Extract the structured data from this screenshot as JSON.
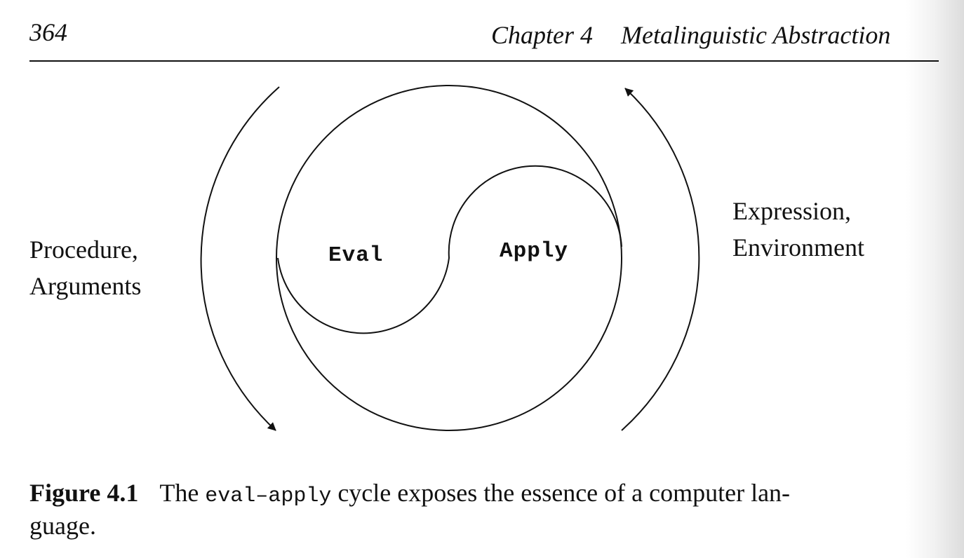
{
  "header": {
    "page_number": "364",
    "chapter": "Chapter 4",
    "title": "Metalinguistic Abstraction"
  },
  "figure": {
    "left_label": [
      "Procedure,",
      "Arguments"
    ],
    "right_label": [
      "Expression,",
      "Environment"
    ],
    "eval_label": "Eval",
    "apply_label": "Apply"
  },
  "caption": {
    "number": "Figure 4.1",
    "text_before": "The",
    "code": "eval–apply",
    "text_after": "cycle exposes the essence of a computer lan-",
    "text_line2": "guage."
  }
}
